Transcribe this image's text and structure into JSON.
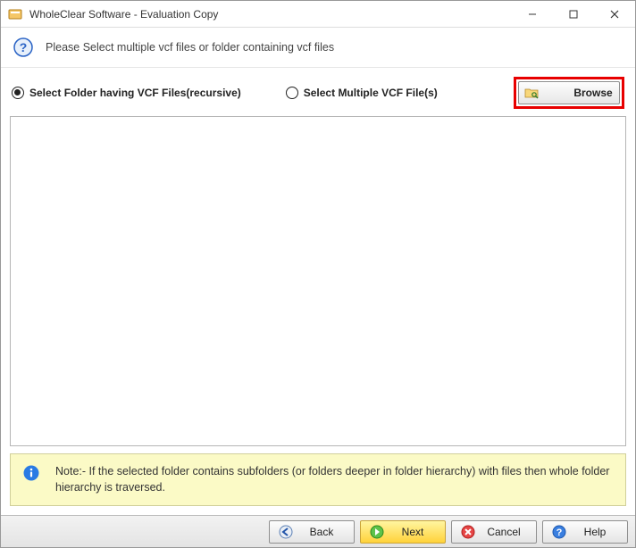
{
  "title": "WholeClear Software - Evaluation Copy",
  "header": {
    "instruction": "Please Select multiple vcf files or folder containing vcf files"
  },
  "options": {
    "radio_folder": "Select Folder having VCF Files(recursive)",
    "radio_files": "Select Multiple VCF File(s)",
    "selected": "folder",
    "browse_label": "Browse"
  },
  "note": {
    "text": "Note:- If the selected folder contains subfolders (or folders deeper in folder hierarchy) with files then whole folder hierarchy is traversed."
  },
  "footer": {
    "back": "Back",
    "next": "Next",
    "cancel": "Cancel",
    "help": "Help"
  }
}
